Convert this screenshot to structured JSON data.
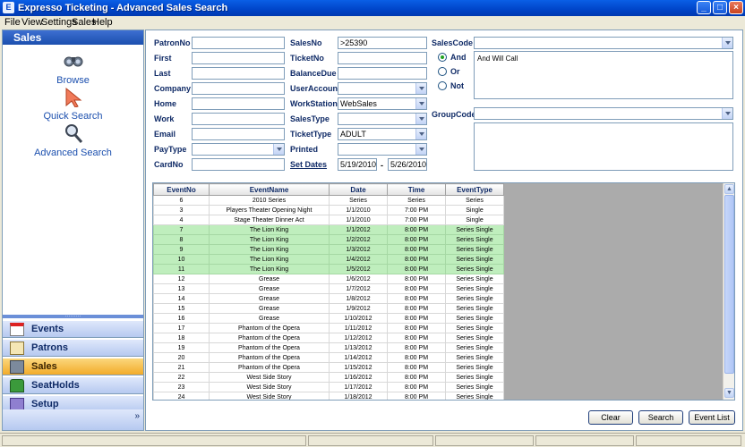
{
  "window": {
    "title": "Expresso Ticketing - Advanced Sales Search"
  },
  "menu": [
    "File",
    "View",
    "Settings",
    "Sales",
    "Help"
  ],
  "sidebar": {
    "header": "Sales",
    "links": [
      {
        "label": "Browse",
        "icon": "binoculars-icon"
      },
      {
        "label": "Quick Search",
        "icon": "cursor-arrow-icon"
      },
      {
        "label": "Advanced Search",
        "icon": "magnifier-icon"
      }
    ],
    "modules": [
      {
        "label": "Events",
        "icon": "calendar-icon",
        "active": false
      },
      {
        "label": "Patrons",
        "icon": "address-card-icon",
        "active": false
      },
      {
        "label": "Sales",
        "icon": "cash-register-icon",
        "active": true
      },
      {
        "label": "SeatHolds",
        "icon": "seat-icon",
        "active": false
      },
      {
        "label": "Setup",
        "icon": "setup-box-icon",
        "active": false
      }
    ],
    "expand_glyph": "»"
  },
  "form": {
    "patronno": {
      "label": "PatronNo",
      "value": ""
    },
    "first": {
      "label": "First",
      "value": ""
    },
    "last": {
      "label": "Last",
      "value": ""
    },
    "company": {
      "label": "Company",
      "value": ""
    },
    "home": {
      "label": "Home",
      "value": ""
    },
    "work": {
      "label": "Work",
      "value": ""
    },
    "email": {
      "label": "Email",
      "value": ""
    },
    "paytype": {
      "label": "PayType",
      "value": ""
    },
    "cardno": {
      "label": "CardNo",
      "value": ""
    },
    "salesno": {
      "label": "SalesNo",
      "value": ">25390"
    },
    "ticketno": {
      "label": "TicketNo",
      "value": ""
    },
    "balancedue": {
      "label": "BalanceDue",
      "value": ""
    },
    "useraccount": {
      "label": "UserAccount",
      "value": ""
    },
    "workstation": {
      "label": "WorkStation",
      "value": "WebSales"
    },
    "salestype": {
      "label": "SalesType",
      "value": ""
    },
    "tickettype": {
      "label": "TicketType",
      "value": "ADULT"
    },
    "printed": {
      "label": "Printed",
      "value": ""
    },
    "setdates": {
      "label": "Set Dates",
      "from": "5/19/2010",
      "sep": "-",
      "to": "5/26/2010"
    },
    "salescode": {
      "label": "SalesCode",
      "value": "",
      "list_text": "And Will Call"
    },
    "logic": {
      "and": "And",
      "or": "Or",
      "not": "Not",
      "selected": "And"
    },
    "groupcode": {
      "label": "GroupCode",
      "value": "",
      "list_text": ""
    }
  },
  "grid": {
    "columns": [
      "EventNo",
      "EventName",
      "Date",
      "Time",
      "EventType"
    ],
    "rows": [
      [
        "6",
        "2010 Series",
        "Series",
        "Series",
        "Series"
      ],
      [
        "3",
        "Players Theater Opening Night",
        "1/1/2010",
        "7:00 PM",
        "Single"
      ],
      [
        "4",
        "Stage Theater Dinner Act",
        "1/1/2010",
        "7:00 PM",
        "Single"
      ],
      [
        "7",
        "The Lion King",
        "1/1/2012",
        "8:00 PM",
        "Series Single"
      ],
      [
        "8",
        "The Lion King",
        "1/2/2012",
        "8:00 PM",
        "Series Single"
      ],
      [
        "9",
        "The Lion King",
        "1/3/2012",
        "8:00 PM",
        "Series Single"
      ],
      [
        "10",
        "The Lion King",
        "1/4/2012",
        "8:00 PM",
        "Series Single"
      ],
      [
        "11",
        "The Lion King",
        "1/5/2012",
        "8:00 PM",
        "Series Single"
      ],
      [
        "12",
        "Grease",
        "1/6/2012",
        "8:00 PM",
        "Series Single"
      ],
      [
        "13",
        "Grease",
        "1/7/2012",
        "8:00 PM",
        "Series Single"
      ],
      [
        "14",
        "Grease",
        "1/8/2012",
        "8:00 PM",
        "Series Single"
      ],
      [
        "15",
        "Grease",
        "1/9/2012",
        "8:00 PM",
        "Series Single"
      ],
      [
        "16",
        "Grease",
        "1/10/2012",
        "8:00 PM",
        "Series Single"
      ],
      [
        "17",
        "Phantom of the Opera",
        "1/11/2012",
        "8:00 PM",
        "Series Single"
      ],
      [
        "18",
        "Phantom of the Opera",
        "1/12/2012",
        "8:00 PM",
        "Series Single"
      ],
      [
        "19",
        "Phantom of the Opera",
        "1/13/2012",
        "8:00 PM",
        "Series Single"
      ],
      [
        "20",
        "Phantom of the Opera",
        "1/14/2012",
        "8:00 PM",
        "Series Single"
      ],
      [
        "21",
        "Phantom of the Opera",
        "1/15/2012",
        "8:00 PM",
        "Series Single"
      ],
      [
        "22",
        "West Side Story",
        "1/16/2012",
        "8:00 PM",
        "Series Single"
      ],
      [
        "23",
        "West Side Story",
        "1/17/2012",
        "8:00 PM",
        "Series Single"
      ],
      [
        "24",
        "West Side Story",
        "1/18/2012",
        "8:00 PM",
        "Series Single"
      ]
    ],
    "highlighted_rows": [
      3,
      4,
      5,
      6,
      7
    ],
    "highlight_color": "#bfeebd"
  },
  "buttons": {
    "clear": "Clear",
    "search": "Search",
    "event_list": "Event List"
  },
  "colors": {
    "title_bar": "#0044c8",
    "accent_label": "#0f2a66",
    "active_module": "#f2ab2a"
  }
}
